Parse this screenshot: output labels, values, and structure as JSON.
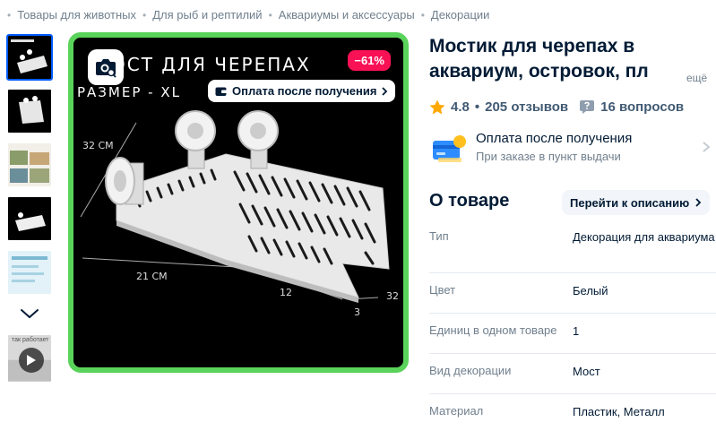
{
  "breadcrumbs": [
    "Товары для животных",
    "Для рыб и рептилий",
    "Аквариумы и аксессуары",
    "Декорации"
  ],
  "gallery": {
    "discount_badge": "−61%",
    "payment_chip": "Оплата после получения",
    "image_text": {
      "heading": "ОСТ ДЛЯ ЧЕРЕПАХ",
      "size": "РАЗМЕР - XL",
      "dim_32_left": "32 CM",
      "dim_21": "21 CM",
      "dim_12": "12",
      "dim_3": "3",
      "dim_32_right": "32"
    },
    "video_thumb_text": "так работает"
  },
  "product": {
    "title_line1": "Мостик для черепах в",
    "title_line2": "аквариум, островок, пл",
    "more_link": "ещё",
    "rating": "4.8",
    "reviews": "205 отзывов",
    "questions": "16 вопросов"
  },
  "payment": {
    "title": "Оплата после получения",
    "subtitle": "При заказе в пункт выдачи"
  },
  "about": {
    "title": "О товаре",
    "go_to_description": "Перейти к описанию",
    "specs": [
      {
        "name": "Тип",
        "value": "Декорация для аквариума"
      },
      {
        "name": "Цвет",
        "value": "Белый"
      },
      {
        "name": "Единиц в одном товаре",
        "value": "1"
      },
      {
        "name": "Вид декорации",
        "value": "Мост"
      },
      {
        "name": "Материал",
        "value": "Пластик, Металл"
      }
    ]
  },
  "colors": {
    "accent_blue": "#005bff",
    "gallery_border": "#5ad35a",
    "discount": "#f91155",
    "star": "#ffa800"
  }
}
